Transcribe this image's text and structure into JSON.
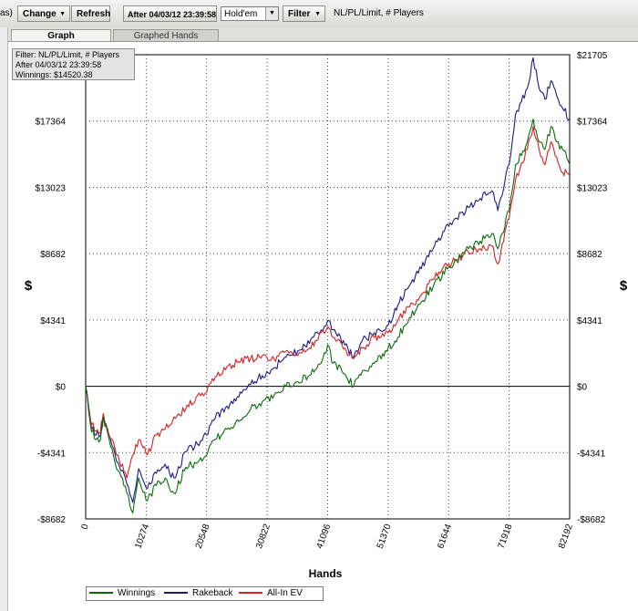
{
  "toolbar": {
    "left_clip": "as)",
    "change_label": "Change",
    "refresh_label": "Refresh",
    "date_filter_label": "After 04/03/12 23:39:58",
    "game_select_value": "Hold'em",
    "filter_label": "Filter",
    "filter_summary": "NL/PL/Limit, # Players"
  },
  "tabs": [
    {
      "label": "Graph",
      "active": true
    },
    {
      "label": "Graphed Hands",
      "active": false
    }
  ],
  "info_box": {
    "line1": "Filter: NL/PL/Limit, # Players",
    "line2": "After 04/03/12 23:39:58",
    "line3": "Winnings: $14520.38"
  },
  "chart_data": {
    "type": "line",
    "xlabel": "Hands",
    "ylabel": "$",
    "xlim": [
      0,
      82192
    ],
    "ylim": [
      -8682,
      21705
    ],
    "x_ticks": [
      0,
      10274,
      20548,
      30822,
      41096,
      51370,
      61644,
      71918,
      82192
    ],
    "y_ticks": [
      -8682,
      -4341,
      0,
      4341,
      8682,
      13023,
      17364
    ],
    "y_tick_labels": [
      "-$8682",
      "-$4341",
      "$0",
      "$4341",
      "$8682",
      "$13023",
      "$17364"
    ],
    "right_top_label": "$21705",
    "grid": true,
    "legend_position": "bottom-left",
    "series": [
      {
        "name": "Winnings",
        "color": "#0b6b0b",
        "x": [
          0,
          1000,
          2500,
          3000,
          4000,
          5500,
          7000,
          8000,
          9000,
          10500,
          12000,
          13500,
          15000,
          17000,
          19000,
          20548,
          22000,
          24000,
          26000,
          28000,
          30000,
          32000,
          34000,
          36000,
          38000,
          40000,
          41096,
          42000,
          44000,
          45500,
          47000,
          49000,
          51370,
          53000,
          55000,
          57000,
          59000,
          61644,
          63000,
          65000,
          67000,
          69000,
          70000,
          71918,
          73000,
          75000,
          76000,
          77000,
          78000,
          79000,
          80000,
          81000,
          82192
        ],
        "values": [
          0,
          -3000,
          -3500,
          -2000,
          -3500,
          -5500,
          -7000,
          -8300,
          -6000,
          -7500,
          -6500,
          -6000,
          -7000,
          -5300,
          -5000,
          -4500,
          -3500,
          -2800,
          -2300,
          -1500,
          -1000,
          -600,
          0,
          300,
          700,
          1500,
          2700,
          1500,
          800,
          0,
          1000,
          1500,
          2500,
          3200,
          4500,
          5500,
          6500,
          7800,
          8200,
          9000,
          9500,
          10000,
          9000,
          11500,
          14500,
          16000,
          17500,
          16000,
          15500,
          17000,
          16000,
          15500,
          14520
        ]
      },
      {
        "name": "Rakeback",
        "color": "#1a1a80",
        "x": [
          0,
          1000,
          2500,
          3000,
          4000,
          5500,
          7000,
          8000,
          9000,
          10500,
          12000,
          13500,
          15000,
          17000,
          19000,
          20548,
          22000,
          24000,
          26000,
          28000,
          30000,
          32000,
          34000,
          36000,
          38000,
          40000,
          41096,
          42000,
          44000,
          45500,
          47000,
          49000,
          51370,
          53000,
          55000,
          57000,
          59000,
          61644,
          63000,
          65000,
          67000,
          69000,
          70000,
          71918,
          73000,
          75000,
          76000,
          77000,
          78000,
          79000,
          80000,
          81000,
          82192
        ],
        "values": [
          0,
          -2800,
          -3200,
          -1800,
          -3200,
          -5000,
          -6400,
          -7600,
          -5400,
          -6700,
          -5700,
          -5100,
          -6000,
          -4300,
          -3800,
          -3200,
          -2100,
          -1300,
          -700,
          100,
          700,
          1200,
          1900,
          2300,
          2800,
          3700,
          4300,
          3700,
          2700,
          1900,
          3000,
          3500,
          4000,
          5300,
          6600,
          7700,
          9000,
          10500,
          11000,
          11700,
          12300,
          12800,
          11500,
          14500,
          17800,
          19500,
          21500,
          19500,
          18800,
          20000,
          19000,
          18200,
          17500
        ]
      },
      {
        "name": "All-In EV",
        "color": "#d42020",
        "x": [
          0,
          1000,
          2500,
          3000,
          4000,
          5500,
          7000,
          8000,
          9000,
          10500,
          12000,
          13500,
          15000,
          17000,
          19000,
          20548,
          22000,
          24000,
          26000,
          28000,
          30000,
          32000,
          34000,
          36000,
          38000,
          40000,
          41096,
          42000,
          44000,
          45500,
          47000,
          49000,
          51370,
          53000,
          55000,
          57000,
          59000,
          61644,
          63000,
          65000,
          67000,
          69000,
          70000,
          71918,
          73000,
          75000,
          76000,
          77000,
          78000,
          79000,
          80000,
          81000,
          82192
        ],
        "values": [
          0,
          -2500,
          -3000,
          -1800,
          -3300,
          -4500,
          -6000,
          -4500,
          -3500,
          -4500,
          -3200,
          -2800,
          -2000,
          -1500,
          -600,
          -400,
          600,
          1300,
          1600,
          1800,
          2000,
          1800,
          2300,
          2000,
          2500,
          3500,
          3900,
          3200,
          2500,
          1800,
          2500,
          3200,
          3500,
          4300,
          5200,
          6000,
          7000,
          8000,
          8300,
          8800,
          9000,
          9200,
          8000,
          11000,
          13500,
          15500,
          17000,
          15500,
          14500,
          16000,
          15000,
          14000,
          13800
        ]
      }
    ]
  }
}
